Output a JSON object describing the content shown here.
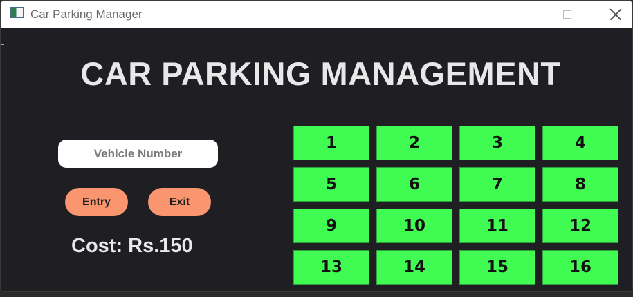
{
  "window": {
    "title": "Car Parking Manager",
    "icons": {
      "app": "app-icon",
      "minimize": "minimize-icon",
      "maximize": "maximize-icon",
      "close": "close-icon"
    }
  },
  "main": {
    "heading": "CAR PARKING MANAGEMENT",
    "vehicle_input": {
      "placeholder": "Vehicle Number",
      "value": ""
    },
    "entry_label": "Entry",
    "exit_label": "Exit",
    "cost_text": "Cost: Rs.150"
  },
  "slots": [
    "1",
    "2",
    "3",
    "4",
    "5",
    "6",
    "7",
    "8",
    "9",
    "10",
    "11",
    "12",
    "13",
    "14",
    "15",
    "16"
  ],
  "colors": {
    "background": "#1f1e23",
    "slot_free": "#40fb52",
    "button": "#f9956f",
    "heading_text": "#e8e8e8"
  }
}
